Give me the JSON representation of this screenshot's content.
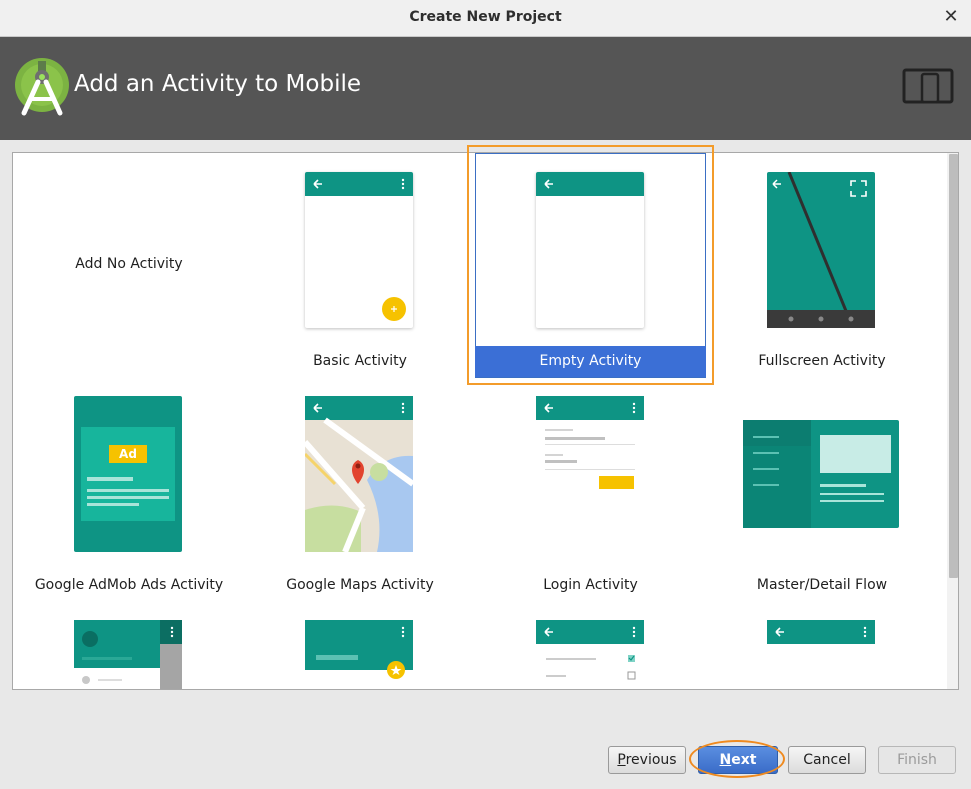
{
  "window": {
    "title": "Create New Project",
    "close_glyph": "✕"
  },
  "header": {
    "title": "Add an Activity to Mobile",
    "logo_icon": "android-studio-logo-icon",
    "device_icon": "phone-tablet-icon"
  },
  "colors": {
    "teal": "#0e9484",
    "selection_orange": "#f39c2b",
    "selection_blue": "#3b6fd6"
  },
  "activities": {
    "no_activity": "Add No Activity",
    "basic": "Basic Activity",
    "empty": "Empty Activity",
    "fullscreen": "Fullscreen Activity",
    "admob": "Google AdMob Ads Activity",
    "admob_badge": "Ad",
    "maps": "Google Maps Activity",
    "login": "Login Activity",
    "master_detail": "Master/Detail Flow"
  },
  "selected": "Empty Activity",
  "buttons": {
    "previous_mnemonic": "P",
    "previous_rest": "revious",
    "next_mnemonic": "N",
    "next_rest": "ext",
    "cancel": "Cancel",
    "finish": "Finish"
  }
}
